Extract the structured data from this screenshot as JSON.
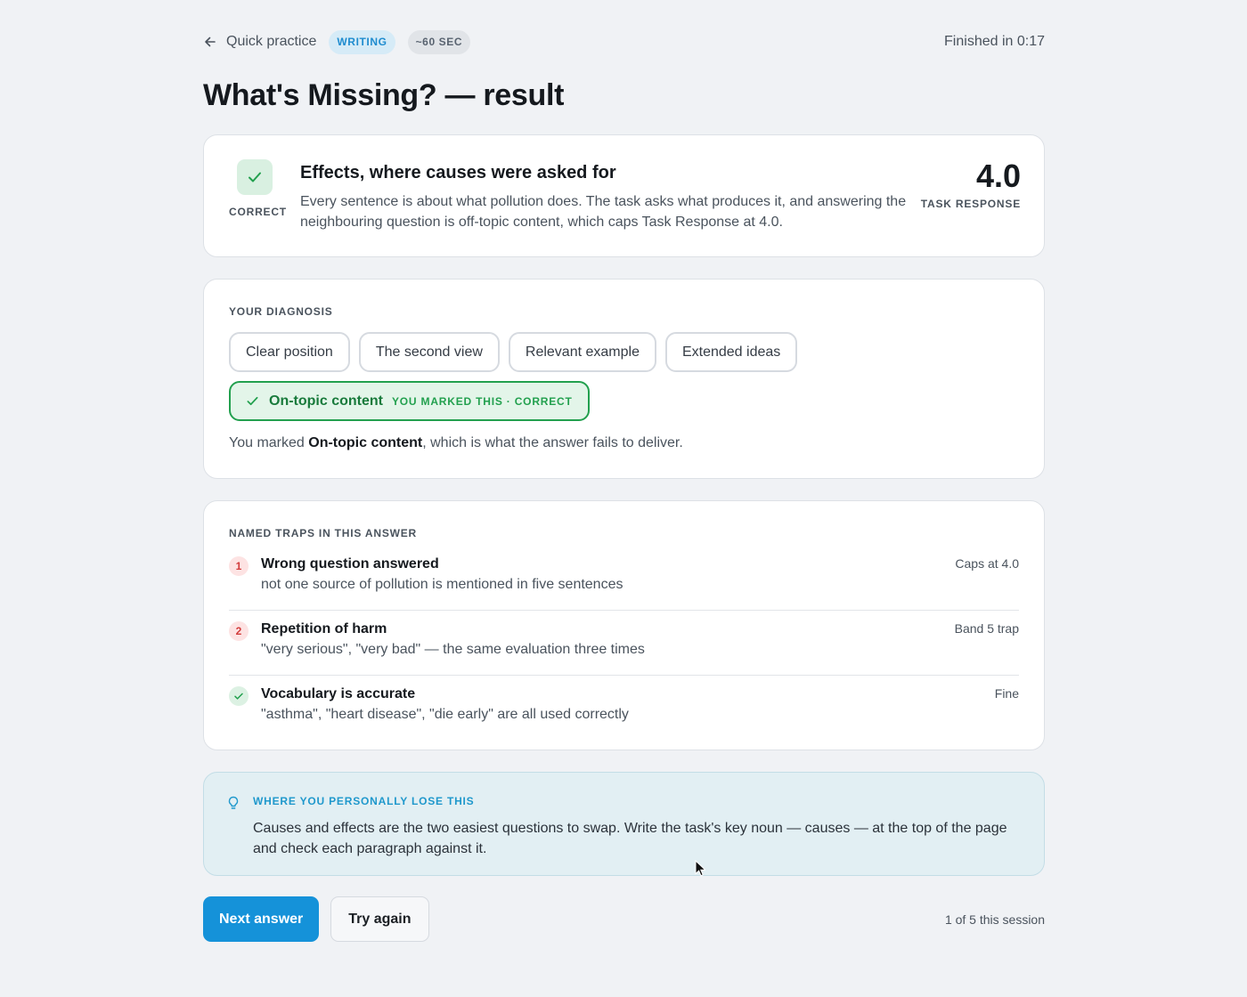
{
  "header": {
    "back_label": "Quick practice",
    "category_chip": "WRITING",
    "duration_chip": "~60 SEC",
    "finished_text": "Finished in 0:17"
  },
  "page_title": "What's Missing? — result",
  "result": {
    "verdict": "CORRECT",
    "title": "Effects, where causes were asked for",
    "body": "Every sentence is about what pollution does. The task asks what produces it, and answering the neighbouring question is off-topic content, which caps Task Response at 4.0.",
    "score": "4.0",
    "score_label": "TASK RESPONSE"
  },
  "diagnosis": {
    "label": "YOUR DIAGNOSIS",
    "options": [
      "Clear position",
      "The second view",
      "Relevant example",
      "Extended ideas"
    ],
    "selected": {
      "label": "On-topic content",
      "tag": "YOU MARKED THIS · CORRECT"
    },
    "note_prefix": "You marked ",
    "note_bold": "On-topic content",
    "note_suffix": ", which is what the answer fails to deliver."
  },
  "traps": {
    "label": "NAMED TRAPS IN THIS ANSWER",
    "items": [
      {
        "badge": "1",
        "title": "Wrong question answered",
        "desc": "not one source of pollution is mentioned in five sentences",
        "tag": "Caps at 4.0"
      },
      {
        "badge": "2",
        "title": "Repetition of harm",
        "desc": "\"very serious\", \"very bad\" — the same evaluation three times",
        "tag": "Band 5 trap"
      },
      {
        "badge": "check-icon",
        "title": "Vocabulary is accurate",
        "desc": "\"asthma\", \"heart disease\", \"die early\" are all used correctly",
        "tag": "Fine"
      }
    ]
  },
  "tip": {
    "icon": "lightbulb-icon",
    "label": "WHERE YOU PERSONALLY LOSE THIS",
    "text": "Causes and effects are the two easiest questions to swap. Write the task's key noun — causes — at the top of the page and check each paragraph against it."
  },
  "actions": {
    "primary": "Next answer",
    "secondary": "Try again",
    "session_count": "1 of 5 this session"
  },
  "colors": {
    "accent": "#1592d9",
    "success": "#22a04e",
    "danger": "#d23b3b",
    "background": "#f0f2f5"
  }
}
